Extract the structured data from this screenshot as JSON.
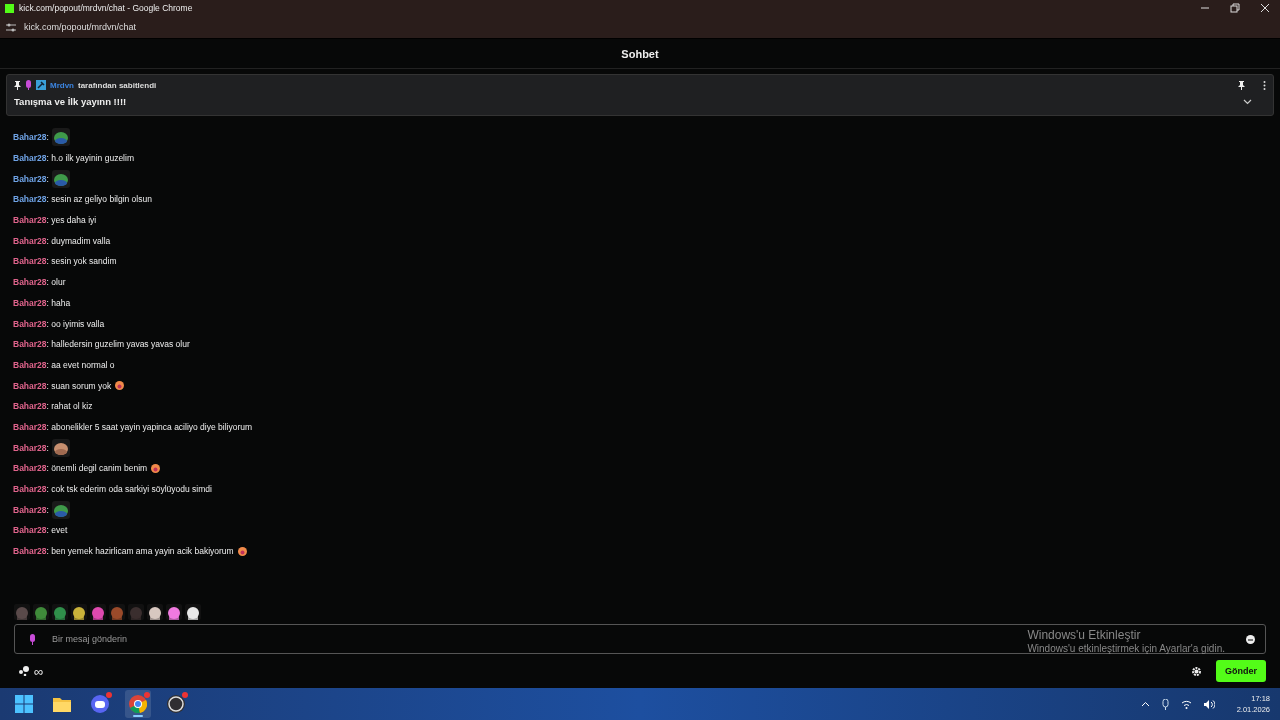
{
  "browser": {
    "title": "kick.com/popout/mrdvn/chat - Google Chrome",
    "url": "kick.com/popout/mrdvn/chat"
  },
  "header": {
    "title": "Sohbet"
  },
  "pinned": {
    "user": "Mrdvn",
    "label": "tarafından sabitlendi",
    "message": "Tanışma ve İlk yayınn !!!!"
  },
  "messages": [
    {
      "user": "Bahar28",
      "color": "#6fa3e6",
      "kind": "emote",
      "text": ":"
    },
    {
      "user": "Bahar28",
      "color": "#6fa3e6",
      "kind": "text",
      "text": ": h.o ilk yayinin guzelim",
      "emoji": false
    },
    {
      "user": "Bahar28",
      "color": "#6fa3e6",
      "kind": "emote",
      "text": ":"
    },
    {
      "user": "Bahar28",
      "color": "#6fa3e6",
      "kind": "text",
      "text": ": sesin az geliyo bilgin olsun",
      "emoji": false
    },
    {
      "user": "Bahar28",
      "color": "#e0648c",
      "kind": "text",
      "text": ": yes daha iyi",
      "emoji": false
    },
    {
      "user": "Bahar28",
      "color": "#e0648c",
      "kind": "text",
      "text": ": duymadim valla",
      "emoji": false
    },
    {
      "user": "Bahar28",
      "color": "#e0648c",
      "kind": "text",
      "text": ": sesin yok sandim",
      "emoji": false
    },
    {
      "user": "Bahar28",
      "color": "#e0648c",
      "kind": "text",
      "text": ": olur",
      "emoji": false
    },
    {
      "user": "Bahar28",
      "color": "#e0648c",
      "kind": "text",
      "text": ": haha",
      "emoji": false
    },
    {
      "user": "Bahar28",
      "color": "#e0648c",
      "kind": "text",
      "text": ": oo iyimis valla",
      "emoji": false
    },
    {
      "user": "Bahar28",
      "color": "#e0648c",
      "kind": "text",
      "text": ": halledersin guzelim yavas yavas olur",
      "emoji": false
    },
    {
      "user": "Bahar28",
      "color": "#e0648c",
      "kind": "text",
      "text": ": aa evet normal o",
      "emoji": false
    },
    {
      "user": "Bahar28",
      "color": "#e0648c",
      "kind": "text",
      "text": ": suan sorum yok",
      "emoji": true
    },
    {
      "user": "Bahar28",
      "color": "#e0648c",
      "kind": "text",
      "text": ": rahat ol kiz",
      "emoji": false
    },
    {
      "user": "Bahar28",
      "color": "#e0648c",
      "kind": "text",
      "text": ": abonelikler 5 saat yayin yapinca aciliyo diye biliyorum",
      "emoji": false
    },
    {
      "user": "Bahar28",
      "color": "#e0648c",
      "kind": "emote",
      "text": ":"
    },
    {
      "user": "Bahar28",
      "color": "#e0648c",
      "kind": "text",
      "text": ": önemli degil canim benim",
      "emoji": true
    },
    {
      "user": "Bahar28",
      "color": "#e0648c",
      "kind": "text",
      "text": ": cok tsk ederim oda sarkiyi söylüyodu simdi",
      "emoji": false
    },
    {
      "user": "Bahar28",
      "color": "#e0648c",
      "kind": "emote",
      "text": ":"
    },
    {
      "user": "Bahar28",
      "color": "#e0648c",
      "kind": "text",
      "text": ": evet",
      "emoji": false
    },
    {
      "user": "Bahar28",
      "color": "#e0648c",
      "kind": "text",
      "text": ": ben yemek hazirlicam ama yayin acik bakiyorum",
      "emoji": true
    }
  ],
  "composer": {
    "placeholder": "Bir mesaj gönderin",
    "infinity": "∞",
    "send": "Gönder"
  },
  "activation": {
    "title": "Windows'u Etkinleştir",
    "subtitle": "Windows'u etkinleştirmek için Ayarlar'a gidin."
  },
  "taskbar": {
    "apps": [
      {
        "kind": "start",
        "selected": false,
        "badge": false
      },
      {
        "kind": "folder",
        "selected": false,
        "badge": false
      },
      {
        "kind": "chat",
        "selected": false,
        "badge": true
      },
      {
        "kind": "browser",
        "selected": true,
        "badge": true
      },
      {
        "kind": "recorder",
        "selected": false,
        "badge": true
      }
    ],
    "time": "17:18",
    "date": "2.01.2026"
  }
}
